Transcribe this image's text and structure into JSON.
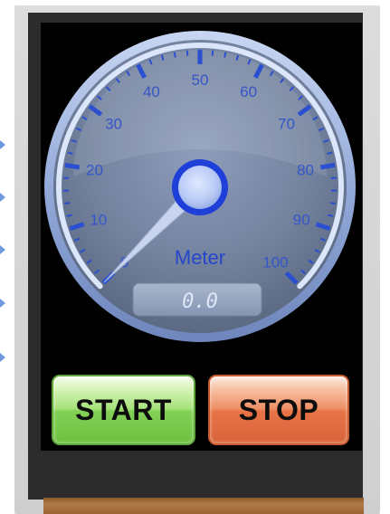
{
  "meter": {
    "label": "Meter",
    "readout": "0.0",
    "value": 0,
    "min": 0,
    "max": 100,
    "tick_labels": [
      "0",
      "10",
      "20",
      "30",
      "40",
      "50",
      "60",
      "70",
      "80",
      "90",
      "100"
    ]
  },
  "buttons": {
    "start_label": "START",
    "stop_label": "STOP"
  },
  "colors": {
    "start_button": "#8fd663",
    "stop_button": "#eb7a4e",
    "gauge_accent": "#2a4fd0",
    "gauge_face": "#6b7c9c"
  }
}
